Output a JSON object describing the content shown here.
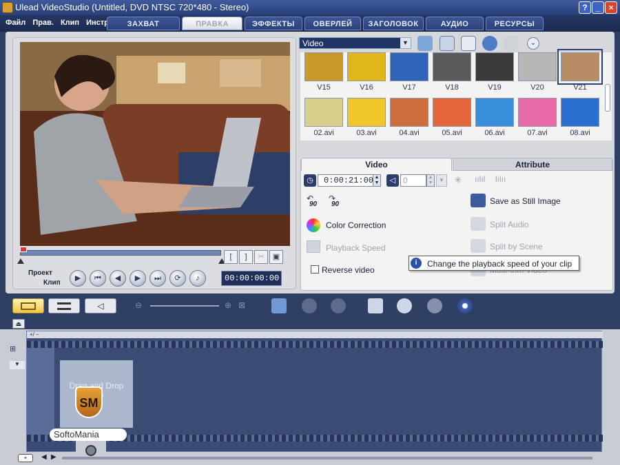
{
  "window": {
    "title": "Ulead VideoStudio (Untitled, DVD NTSC 720*480 - Stereo)"
  },
  "menu": {
    "items": [
      "Файл",
      "Прав.",
      "Клип",
      "Инстр."
    ]
  },
  "steps": {
    "tabs": [
      "ЗАХВАТ",
      "ПРАВКА",
      "ЭФФЕКТЫ",
      "ОВЕРЛЕЙ",
      "ЗАГОЛОВОК",
      "АУДИО",
      "РЕСУРСЫ"
    ],
    "active": "ПРАВКА"
  },
  "preview": {
    "project_label": "Проект",
    "clip_label": "Клип",
    "timecode": "00:00:00:00"
  },
  "library": {
    "category": "Video",
    "row1": [
      "V15",
      "V16",
      "V17",
      "V18",
      "V19",
      "V20",
      "V21"
    ],
    "row2": [
      "02.avi",
      "03.avi",
      "04.avi",
      "05.avi",
      "06.avi",
      "07.avi",
      "08.avi"
    ],
    "selected": "V21",
    "thumb_colors_row1": [
      "#c99a2a",
      "#e0b81c",
      "#2f65b8",
      "#5a5a5a",
      "#3a3a3a",
      "#b7b7b7",
      "#b88c64"
    ],
    "thumb_colors_row2": [
      "#d8cf8a",
      "#f0c62b",
      "#cc6f3c",
      "#e2663a",
      "#3a8fdc",
      "#e86ba8",
      "#2a6fd0"
    ]
  },
  "options": {
    "tab_video": "Video",
    "tab_attribute": "Attribute",
    "duration": "0:00:21:00",
    "volume": "0",
    "rotate_left": "90",
    "rotate_right": "90",
    "color_correction": "Color Correction",
    "playback_speed": "Playback Speed",
    "reverse_video": "Reverse video",
    "save_still": "Save as Still Image",
    "split_audio": "Split Audio",
    "split_scene": "Split by Scene",
    "multitrim": "Multi-trim Video",
    "tooltip": "Change the playback speed of your clip"
  },
  "timeline": {
    "drop_hint": "Drag and Drop Clip",
    "ruler_btn": "+/ −",
    "watermark": "SoftoMania",
    "badge": "SM"
  },
  "colors": {
    "accent": "#2a4078",
    "panel": "#d7d8dc",
    "timeline": "#3b4c75"
  }
}
